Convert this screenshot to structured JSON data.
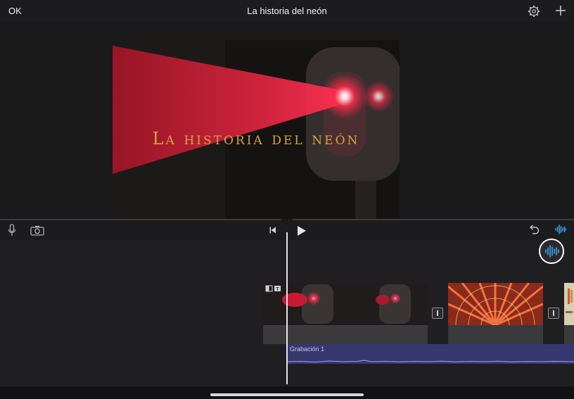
{
  "topbar": {
    "ok_label": "OK",
    "title": "La historia del neón"
  },
  "viewer": {
    "title_overlay": "La historia del neón"
  },
  "timeline": {
    "audio_clip_label": "Grabación 1"
  },
  "colors": {
    "accent": "#3ba6f0",
    "title_text": "#d4a440",
    "audio_track": "#373770"
  },
  "icons": [
    "settings-gear-icon",
    "add-plus-icon",
    "microphone-icon",
    "camera-icon",
    "skip-to-start-icon",
    "play-icon",
    "undo-icon",
    "audio-waveform-icon"
  ]
}
